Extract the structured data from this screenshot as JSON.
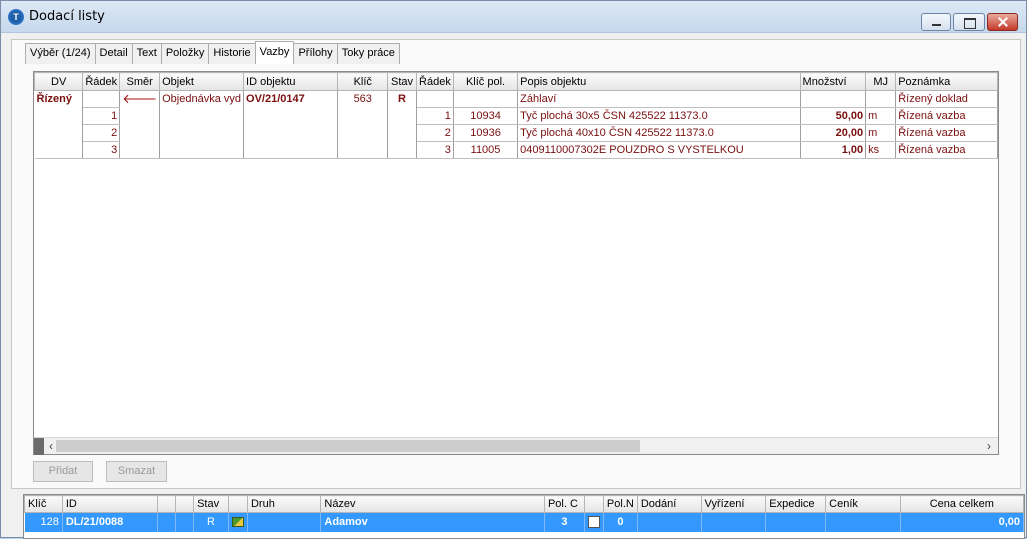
{
  "window": {
    "title": "Dodací  listy",
    "app_icon": "app-logo-icon"
  },
  "tabs": [
    {
      "label": "Výběr (1/24)"
    },
    {
      "label": "Detail"
    },
    {
      "label": "Text"
    },
    {
      "label": "Položky"
    },
    {
      "label": "Historie"
    },
    {
      "label": "Vazby",
      "active": true
    },
    {
      "label": "Přílohy"
    },
    {
      "label": "Toky práce"
    }
  ],
  "links_grid": {
    "columns": [
      "DV",
      "Řádek",
      "Směr",
      "Objekt",
      "ID objektu",
      "Klíč",
      "Stav",
      "Řádek",
      "Klíč pol.",
      "Popis objektu",
      "Množství",
      "MJ",
      "Poznámka"
    ],
    "header_row": {
      "dv": "Řízený",
      "radek": "",
      "smer": "🡐",
      "objekt": "Objednávka vyd",
      "id_objektu": "OV/21/0147",
      "klic": "563",
      "stav": "R",
      "radek2": "",
      "klic_pol": "",
      "popis": "Záhlaví",
      "mnozstvi": "",
      "mj": "",
      "poznamka": "Řízený doklad"
    },
    "rows": [
      {
        "radek": "1",
        "radek2": "1",
        "klic_pol": "10934",
        "popis": "Tyč plochá 30x5 ČSN 425522 11373.0",
        "mnozstvi": "50,00",
        "mj": "m",
        "poznamka": "Řízená vazba"
      },
      {
        "radek": "2",
        "radek2": "2",
        "klic_pol": "10936",
        "popis": "Tyč plochá 40x10 ČSN 425522 11373.0",
        "mnozstvi": "20,00",
        "mj": "m",
        "poznamka": "Řízená vazba"
      },
      {
        "radek": "3",
        "radek2": "3",
        "klic_pol": "11005",
        "popis": "0409110007302E POUZDRO S VYSTELKOU",
        "mnozstvi": "1,00",
        "mj": "ks",
        "poznamka": "Řízená vazba"
      }
    ]
  },
  "buttons": {
    "add": "Přidat",
    "delete": "Smazat"
  },
  "bottom_grid": {
    "columns": [
      "Klíč",
      "ID",
      "",
      "",
      "Stav",
      "",
      "Druh",
      "Název",
      "Pol. C",
      "",
      "Pol.N",
      "Dodání",
      "Vyřízení",
      "Expedice",
      "Ceník",
      "Cena celkem"
    ],
    "row": {
      "klic": "128",
      "id": "DL/21/0088",
      "stav": "R",
      "druh": "",
      "nazev": "Adamov",
      "pol_c": "3",
      "pol_n": "0",
      "dodani": "",
      "vyrizeni": "",
      "expedice": "",
      "cenik": "",
      "cena_celkem": "0,00"
    }
  }
}
